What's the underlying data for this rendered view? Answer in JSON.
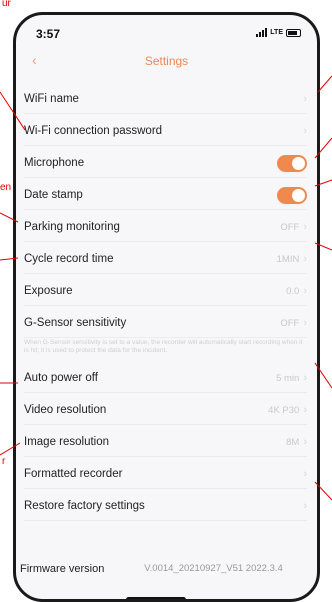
{
  "status_bar": {
    "time": "3:57",
    "network": "LTE"
  },
  "nav": {
    "back_icon": "chevron-left-icon",
    "title": "Settings"
  },
  "settings": [
    {
      "label": "WiFi name",
      "value": "",
      "type": "chevron"
    },
    {
      "label": "Wi-Fi connection password",
      "value": "",
      "type": "chevron"
    },
    {
      "label": "Microphone",
      "value": "",
      "type": "toggle",
      "on": true
    },
    {
      "label": "Date stamp",
      "value": "",
      "type": "toggle",
      "on": true
    },
    {
      "label": "Parking monitoring",
      "value": "OFF",
      "type": "chevron"
    },
    {
      "label": "Cycle record time",
      "value": "1MIN",
      "type": "chevron"
    },
    {
      "label": "Exposure",
      "value": "0.0",
      "type": "chevron"
    },
    {
      "label": "G-Sensor sensitivity",
      "value": "OFF",
      "type": "chevron"
    },
    {
      "label": "Auto power off",
      "value": "5 min",
      "type": "chevron"
    },
    {
      "label": "Video resolution",
      "value": "4K P30",
      "type": "chevron"
    },
    {
      "label": "Image resolution",
      "value": "8M",
      "type": "chevron"
    },
    {
      "label": "Formatted recorder",
      "value": "",
      "type": "chevron"
    },
    {
      "label": "Restore factory settings",
      "value": "",
      "type": "chevron"
    }
  ],
  "gsensor_note": "When G-Sensor sensitivity is set to a value, the recorder will automatically start recording when it is hit; it is used to protect the data for the incident.",
  "firmware": {
    "label": "Firmware version",
    "value": "V.0014_20210927_V51 2022.3.4"
  },
  "annotations": {
    "top_left_fragment": "ur",
    "mid_fragment": "en",
    "bottom_fragment": "r"
  },
  "colors": {
    "accent": "#ee8a4f",
    "annotation": "#e00000"
  }
}
